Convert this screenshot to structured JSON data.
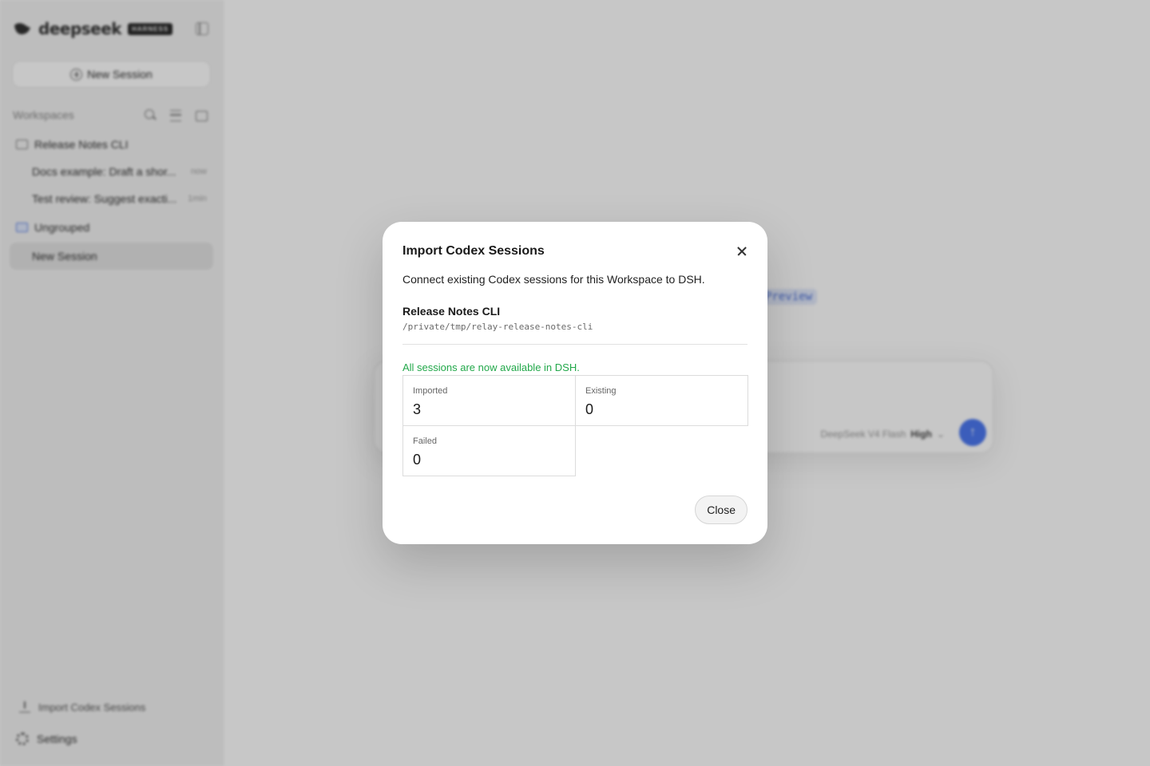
{
  "sidebar": {
    "brand_name": "deepseek",
    "brand_badge": "HARNESS",
    "new_session_label": "New Session",
    "workspaces_title": "Workspaces",
    "groups": [
      {
        "name": "Release Notes CLI",
        "sessions": [
          {
            "title": "Docs example: Draft a shor...",
            "time": "now"
          },
          {
            "title": "Test review: Suggest exacti...",
            "time": "1min"
          }
        ]
      },
      {
        "name": "Ungrouped",
        "sessions": [
          {
            "title": "New Session",
            "time": ""
          }
        ]
      }
    ],
    "import_label": "Import Codex Sessions",
    "settings_label": "Settings"
  },
  "main": {
    "preview_badge": "Preview",
    "composer": {
      "model": "DeepSeek V4 Flash",
      "effort": "High"
    }
  },
  "modal": {
    "title": "Import Codex Sessions",
    "description": "Connect existing Codex sessions for this Workspace to DSH.",
    "workspace_name": "Release Notes CLI",
    "workspace_path": "/private/tmp/relay-release-notes-cli",
    "status_message": "All sessions are now available in DSH.",
    "stats": [
      {
        "label": "Imported",
        "value": "3"
      },
      {
        "label": "Existing",
        "value": "0"
      },
      {
        "label": "Failed",
        "value": "0"
      }
    ],
    "close_label": "Close"
  },
  "colors": {
    "accent": "#4c78f0",
    "success": "#22a84a"
  }
}
